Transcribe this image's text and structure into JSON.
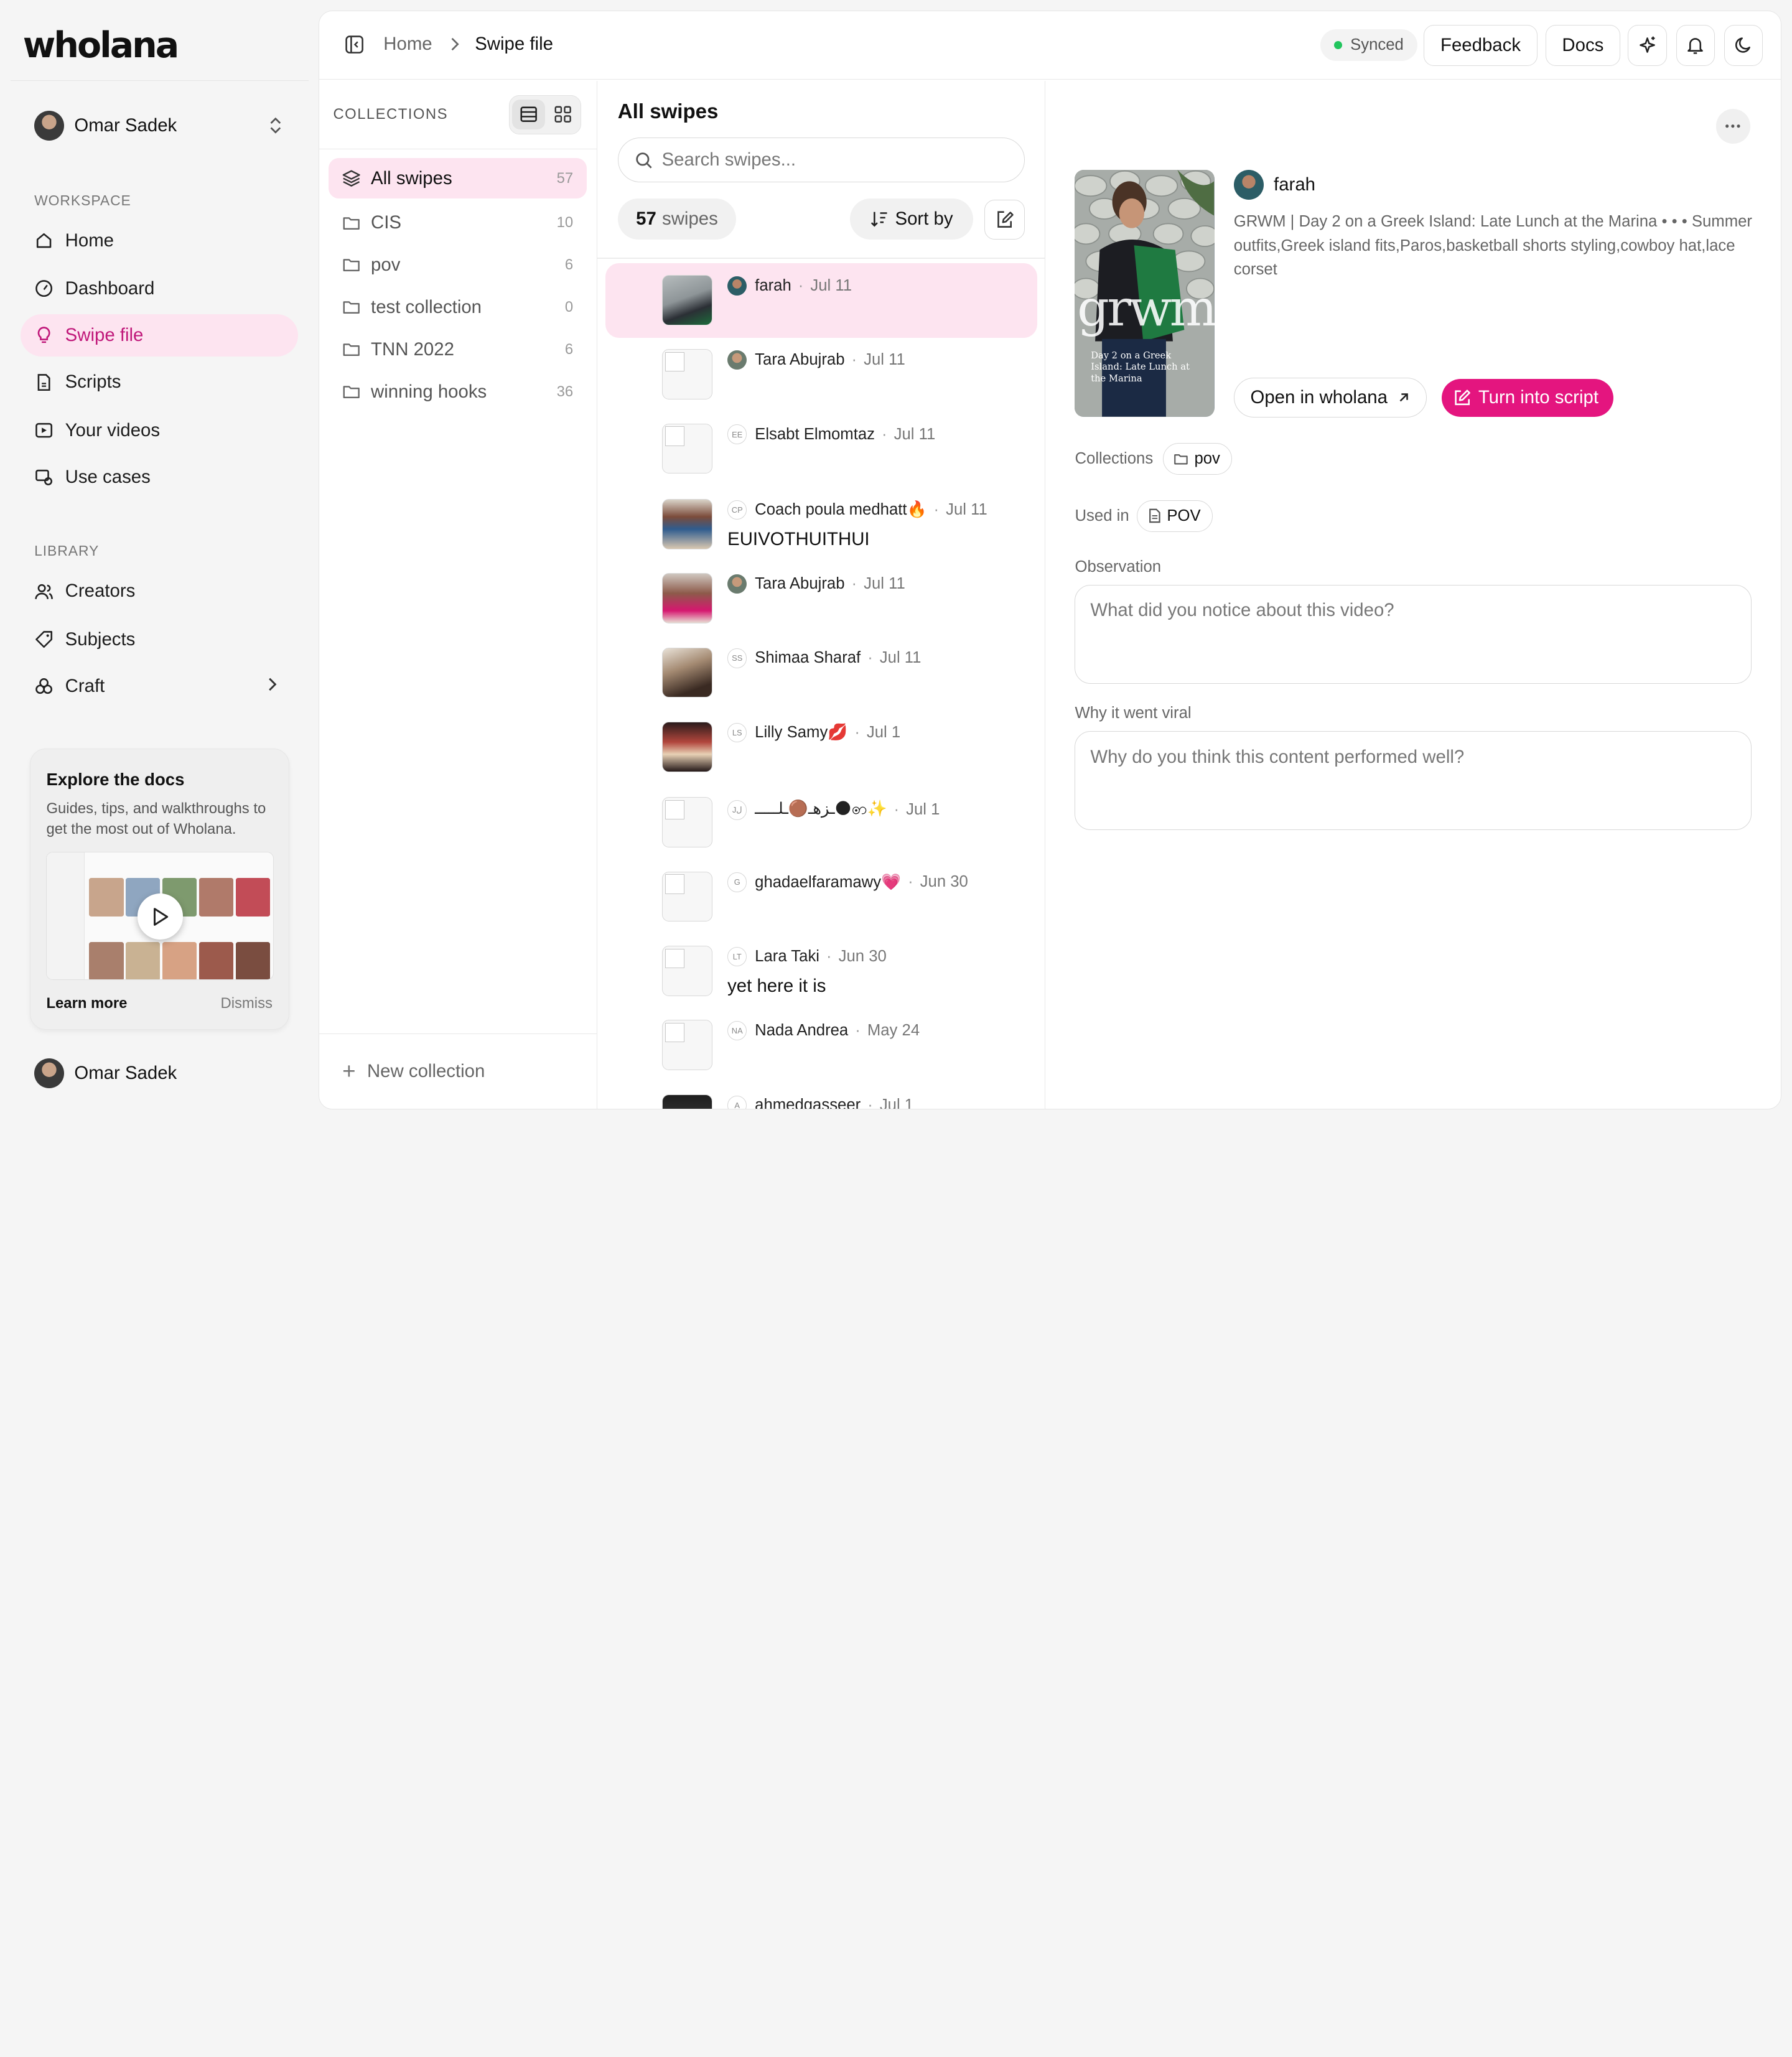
{
  "brand": {
    "logo": "wholana",
    "accent": "#e4157f",
    "accent_soft": "#fde4f0"
  },
  "user": {
    "name": "Omar Sadek"
  },
  "sidebar": {
    "workspace_label": "WORKSPACE",
    "workspace_items": [
      {
        "label": "Home",
        "icon": "home-icon"
      },
      {
        "label": "Dashboard",
        "icon": "gauge-icon"
      },
      {
        "label": "Swipe file",
        "icon": "lightbulb-icon",
        "active": true
      },
      {
        "label": "Scripts",
        "icon": "script-icon"
      },
      {
        "label": "Your videos",
        "icon": "video-icon"
      },
      {
        "label": "Use cases",
        "icon": "use-cases-icon"
      }
    ],
    "library_label": "LIBRARY",
    "library_items": [
      {
        "label": "Creators",
        "icon": "users-icon"
      },
      {
        "label": "Subjects",
        "icon": "tag-icon"
      },
      {
        "label": "Craft",
        "icon": "craft-icon"
      }
    ],
    "explore": {
      "title": "Explore the docs",
      "text": "Guides, tips, and walkthroughs to get the most out of Wholana.",
      "learn_more": "Learn more",
      "dismiss": "Dismiss"
    }
  },
  "topbar": {
    "breadcrumb": {
      "home": "Home",
      "current": "Swipe file"
    },
    "status": "Synced",
    "feedback": "Feedback",
    "docs": "Docs"
  },
  "collections": {
    "title": "COLLECTIONS",
    "items": [
      {
        "label": "All swipes",
        "count": "57",
        "active": true
      },
      {
        "label": "CIS",
        "count": "10"
      },
      {
        "label": "pov",
        "count": "6"
      },
      {
        "label": "test collection",
        "count": "0"
      },
      {
        "label": "TNN 2022",
        "count": "6"
      },
      {
        "label": "winning hooks",
        "count": "36"
      }
    ],
    "new_collection": "New collection"
  },
  "swipes": {
    "title": "All swipes",
    "search_placeholder": "Search swipes...",
    "count": "57",
    "count_label": "swipes",
    "sort_label": "Sort by",
    "items": [
      {
        "initials": "",
        "name": "farah",
        "date": "Jul 11",
        "caption": "",
        "active": true
      },
      {
        "initials": "",
        "name": "Tara Abujrab",
        "date": "Jul 11",
        "caption": ""
      },
      {
        "initials": "EE",
        "name": "Elsabt Elmomtaz",
        "date": "Jul 11",
        "caption": ""
      },
      {
        "initials": "CP",
        "name": "Coach poula medhatt🔥",
        "date": "Jul 11",
        "caption": "EUIVOTHUITHUI"
      },
      {
        "initials": "",
        "name": "Tara Abujrab",
        "date": "Jul 11",
        "caption": ""
      },
      {
        "initials": "SS",
        "name": "Shimaa Sharaf",
        "date": "Jul 11",
        "caption": ""
      },
      {
        "initials": "LS",
        "name": "Lilly Samy💋",
        "date": "Jul 1",
        "caption": ""
      },
      {
        "initials": "Jل",
        "name": "ـزهـ🟤ـلـــــ🌑ꩦ✨",
        "date": "Jul 1",
        "caption": ""
      },
      {
        "initials": "G",
        "name": "ghadaelfaramawy💗",
        "date": "Jun 30",
        "caption": ""
      },
      {
        "initials": "LT",
        "name": "Lara Taki",
        "date": "Jun 30",
        "caption": "yet here it is"
      },
      {
        "initials": "NA",
        "name": "Nada Andrea",
        "date": "May 24",
        "caption": ""
      },
      {
        "initials": "A",
        "name": "ahmedgasseer",
        "date": "Jul 1",
        "caption": ""
      }
    ]
  },
  "detail": {
    "creator": "farah",
    "description": "GRWM | Day 2 on a Greek Island: Late Lunch at the Marina • • • Summer outfits,Greek island fits,Paros,basketball shorts styling,cowboy hat,lace corset",
    "thumb_overlay": "grwm",
    "thumb_sub": "Day 2 on a Greek Island: Late Lunch at the Marina",
    "open_button": "Open in wholana",
    "script_button": "Turn into script",
    "collections_label": "Collections",
    "collection_chip": "pov",
    "used_in_label": "Used in",
    "used_in_chip": "POV",
    "observation_label": "Observation",
    "observation_placeholder": "What did you notice about this video?",
    "viral_label": "Why it went viral",
    "viral_placeholder": "Why do you think this content performed well?"
  }
}
